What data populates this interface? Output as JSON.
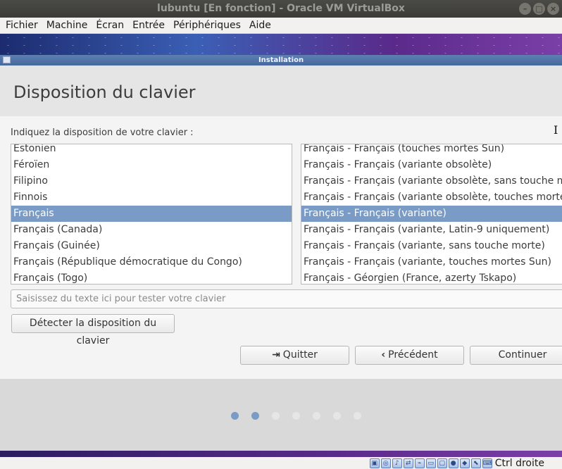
{
  "host_window": {
    "title": "lubuntu [En fonction] - Oracle VM VirtualBox",
    "buttons": [
      "–",
      "□",
      "×"
    ]
  },
  "menubar": {
    "items": [
      "Fichier",
      "Machine",
      "Écran",
      "Entrée",
      "Périphériques",
      "Aide"
    ]
  },
  "installer": {
    "window_title": "Installation",
    "page_title": "Disposition du clavier",
    "prompt": "Indiquez la disposition de votre clavier :",
    "layouts": [
      "Estonien",
      "Féroïen",
      "Filipino",
      "Finnois",
      "Français",
      "Français (Canada)",
      "Français (Guinée)",
      "Français (République démocratique du Congo)",
      "Français (Togo)"
    ],
    "selected_layout": "Français",
    "variants": [
      "Français - Français (touches mortes Sun)",
      "Français - Français (variante obsolète)",
      "Français - Français (variante obsolète, sans touche morte)",
      "Français - Français (variante obsolète, touches mortes Sun)",
      "Français - Français (variante)",
      "Français - Français (variante, Latin-9 uniquement)",
      "Français - Français (variante, sans touche morte)",
      "Français - Français (variante, touches mortes Sun)",
      "Français - Géorgien (France, azerty Tskapo)"
    ],
    "selected_variant": "Français - Français (variante)",
    "test_placeholder": "Saisissez du texte ici pour tester votre clavier",
    "test_value": "",
    "detect_button": "Détecter la disposition du clavier",
    "quit_button": "Quitter",
    "prev_button": "Précédent",
    "next_button": "Continuer",
    "progress": {
      "current_step": 2,
      "total_steps": 7
    }
  },
  "statusbar": {
    "icons": [
      "hard-disk-icon",
      "optical-drive-icon",
      "audio-icon",
      "network-icon",
      "usb-icon",
      "shared-folders-icon",
      "display-icon",
      "video-capture-icon",
      "virtualization-icon",
      "mouse-integration-icon",
      "keyboard-icon"
    ],
    "host_key": "Ctrl droite"
  },
  "colors": {
    "selection": "#7a9bc6",
    "installer_titlebar": "#5e7fb0",
    "host_titlebar": "#3c3b37"
  }
}
